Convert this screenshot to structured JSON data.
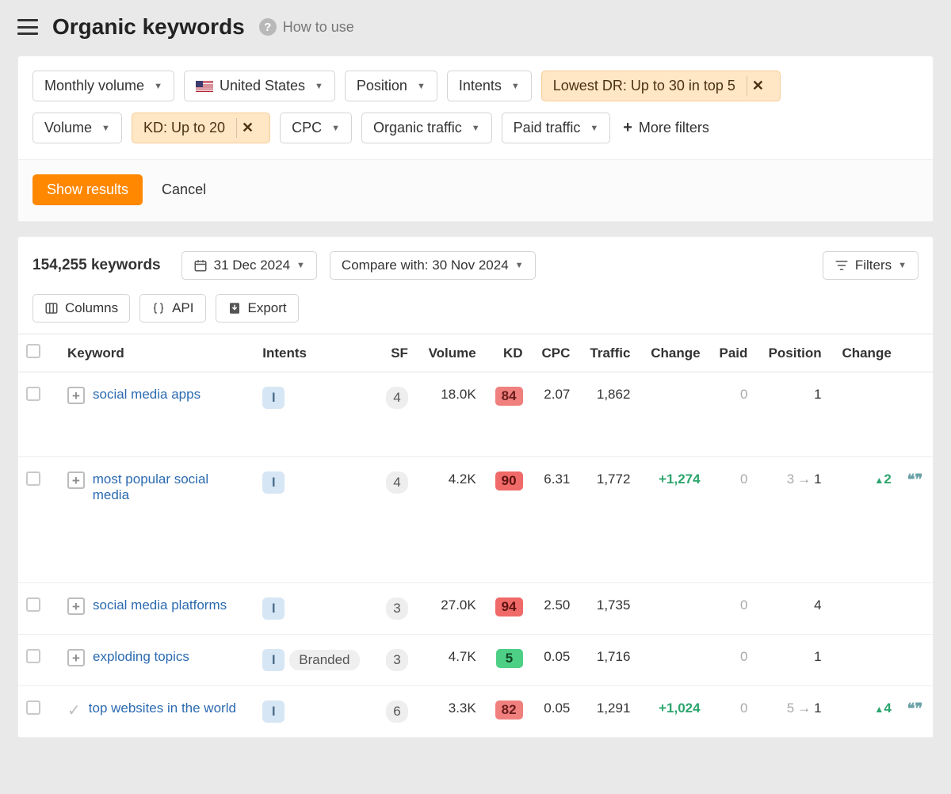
{
  "header": {
    "title": "Organic keywords",
    "how_to_use": "How to use"
  },
  "filters_row1": {
    "monthly_volume": "Monthly volume",
    "country": "United States",
    "position": "Position",
    "intents": "Intents",
    "lowest_dr": "Lowest DR: Up to 30 in top 5"
  },
  "filters_row2": {
    "volume": "Volume",
    "kd": "KD: Up to 20",
    "cpc": "CPC",
    "organic_traffic": "Organic traffic",
    "paid_traffic": "Paid traffic",
    "more_filters": "More filters"
  },
  "actions": {
    "show_results": "Show results",
    "cancel": "Cancel"
  },
  "toolbar": {
    "count_label": "154,255 keywords",
    "date": "31 Dec 2024",
    "compare": "Compare with: 30 Nov 2024",
    "filters_btn": "Filters",
    "columns": "Columns",
    "api": "API",
    "export": "Export"
  },
  "columns": {
    "keyword": "Keyword",
    "intents": "Intents",
    "sf": "SF",
    "volume": "Volume",
    "kd": "KD",
    "cpc": "CPC",
    "traffic": "Traffic",
    "change": "Change",
    "paid": "Paid",
    "position": "Position",
    "change2": "Change"
  },
  "rows": [
    {
      "keyword": "social media apps",
      "intent": "I",
      "branded": "",
      "sf": "4",
      "volume": "18.0K",
      "kd": "84",
      "kd_class": "kd-red",
      "cpc": "2.07",
      "traffic": "1,862",
      "change": "",
      "paid": "0",
      "pos_from": "",
      "pos_to": "1",
      "pos_change": "",
      "quote": false,
      "checked": false
    },
    {
      "keyword": "most popular social media",
      "intent": "I",
      "branded": "",
      "sf": "4",
      "volume": "4.2K",
      "kd": "90",
      "kd_class": "kd-redd",
      "cpc": "6.31",
      "traffic": "1,772",
      "change": "+1,274",
      "paid": "0",
      "pos_from": "3",
      "pos_to": "1",
      "pos_change": "2",
      "quote": true,
      "checked": false
    },
    {
      "keyword": "social media platforms",
      "intent": "I",
      "branded": "",
      "sf": "3",
      "volume": "27.0K",
      "kd": "94",
      "kd_class": "kd-redd",
      "cpc": "2.50",
      "traffic": "1,735",
      "change": "",
      "paid": "0",
      "pos_from": "",
      "pos_to": "4",
      "pos_change": "",
      "quote": false,
      "checked": false
    },
    {
      "keyword": "exploding topics",
      "intent": "I",
      "branded": "Branded",
      "sf": "3",
      "volume": "4.7K",
      "kd": "5",
      "kd_class": "kd-green",
      "cpc": "0.05",
      "traffic": "1,716",
      "change": "",
      "paid": "0",
      "pos_from": "",
      "pos_to": "1",
      "pos_change": "",
      "quote": false,
      "checked": false
    },
    {
      "keyword": "top websites in the world",
      "intent": "I",
      "branded": "",
      "sf": "6",
      "volume": "3.3K",
      "kd": "82",
      "kd_class": "kd-red",
      "cpc": "0.05",
      "traffic": "1,291",
      "change": "+1,024",
      "paid": "0",
      "pos_from": "5",
      "pos_to": "1",
      "pos_change": "4",
      "quote": true,
      "checked": true
    }
  ]
}
